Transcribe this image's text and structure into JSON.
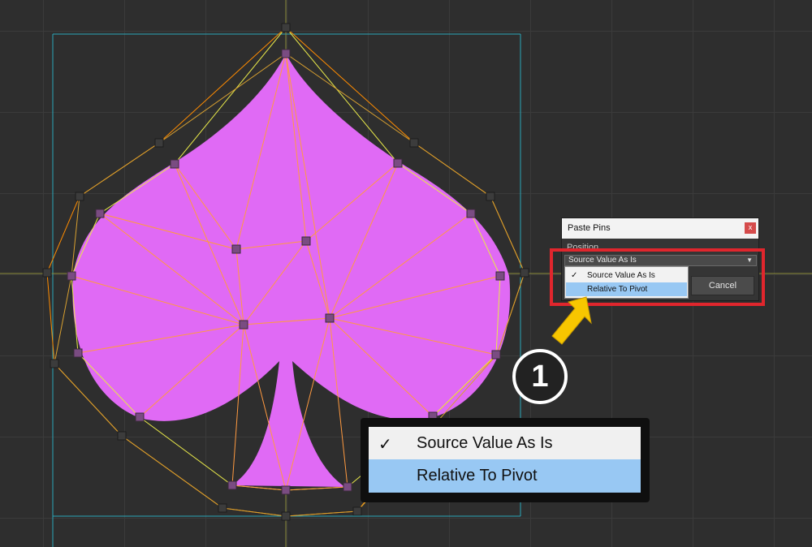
{
  "dialog": {
    "title": "Paste Pins",
    "close_label": "x",
    "position_label": "Position",
    "selected_value": "Source Value As Is",
    "options": [
      {
        "label": "Source Value As Is",
        "checked": true
      },
      {
        "label": "Relative To Pivot",
        "highlighted": true
      }
    ],
    "cancel_label": "Cancel"
  },
  "callout": {
    "step_number": "1",
    "zoom_options": [
      {
        "label": "Source Value As Is",
        "check": "✓"
      },
      {
        "label": "Relative To Pivot"
      }
    ]
  },
  "colors": {
    "spade_fill": "#e06af5",
    "mesh_line": "#ff8c00",
    "outline_line": "#e8e84a",
    "guide_line": "#2aa7b8",
    "highlight": "#e0262d",
    "arrow": "#f7c600",
    "dropdown_highlight": "#98c8f3"
  },
  "icons": {
    "check": "check-icon",
    "dropdown": "chevron-down-icon",
    "close": "close-icon"
  }
}
